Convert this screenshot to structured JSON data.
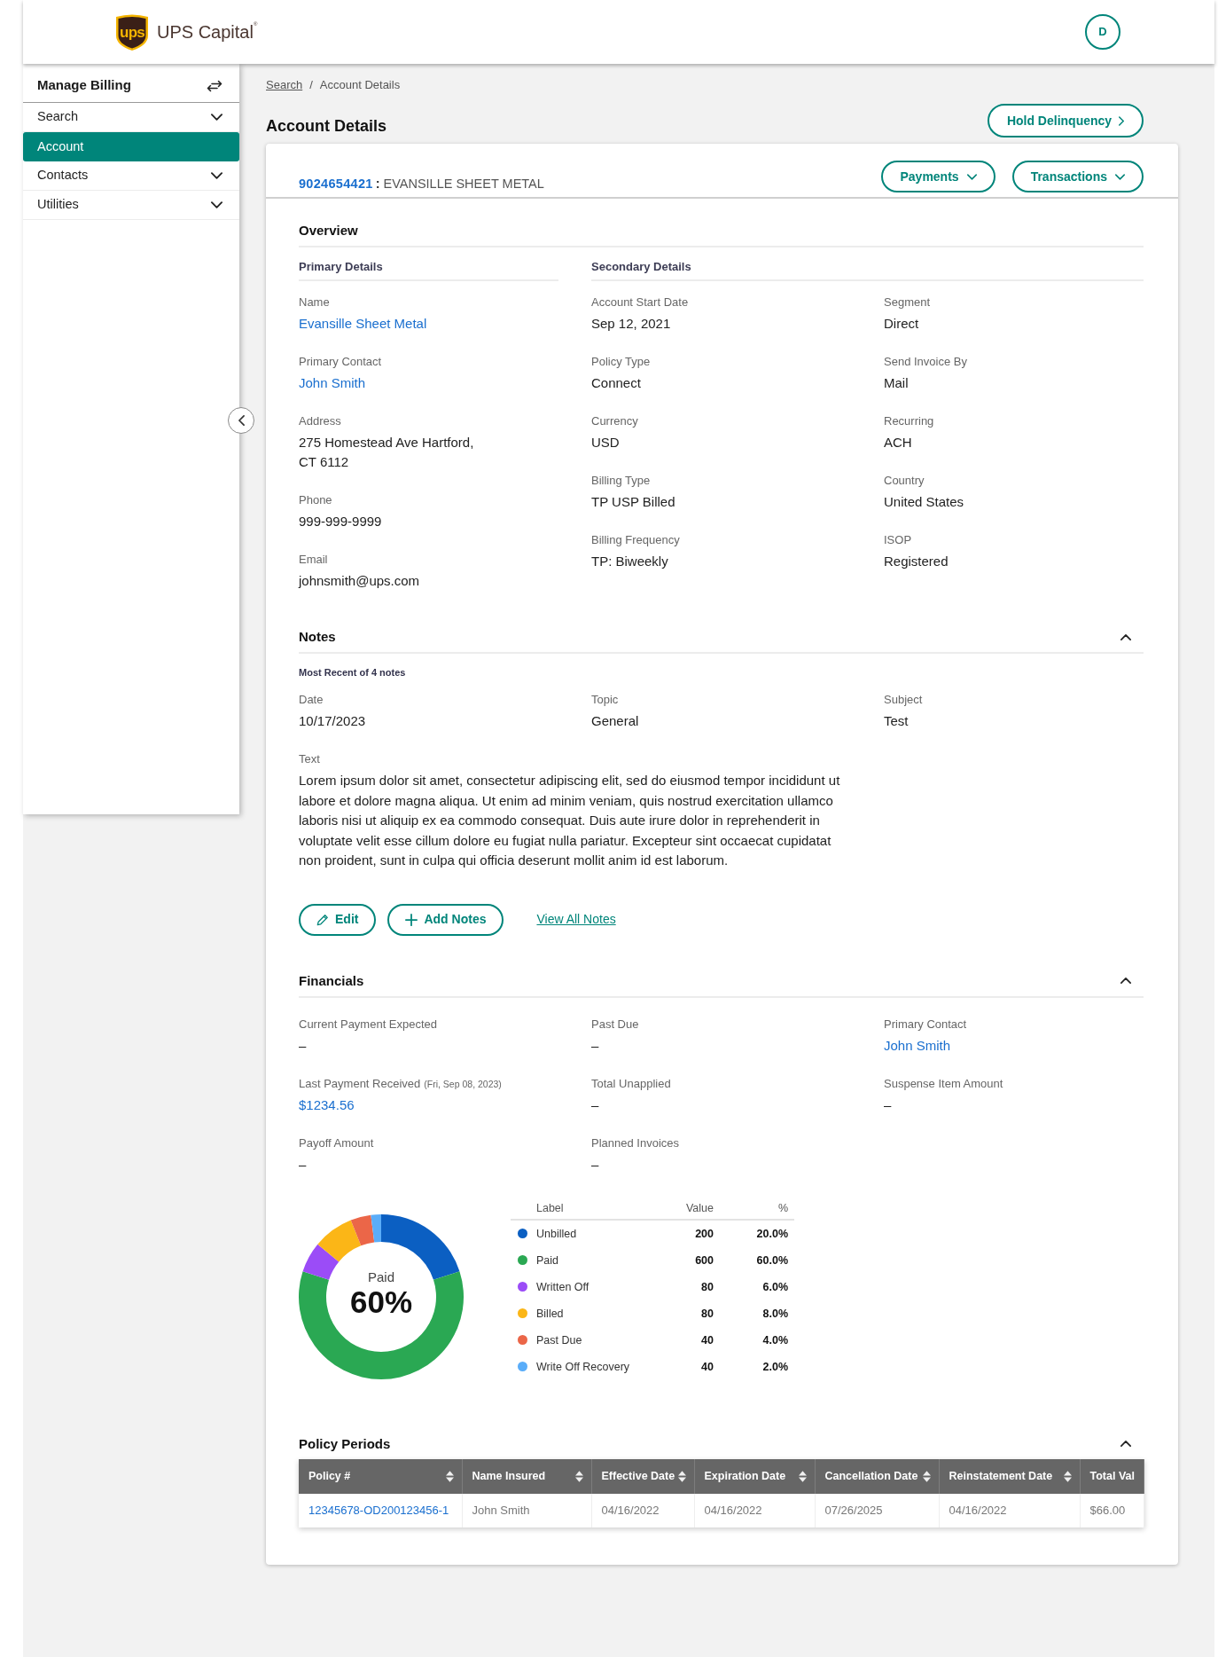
{
  "header": {
    "logo": {
      "mark": "ups",
      "name": "UPS Capital$^{®}$"
    },
    "avatar": "D"
  },
  "sidebar": {
    "title": "Manage Billing",
    "items": [
      {
        "label": "Search",
        "kind": "group",
        "selected": false
      },
      {
        "label": "Account",
        "kind": "link",
        "selected": true
      },
      {
        "label": "Contacts",
        "kind": "group",
        "selected": false
      },
      {
        "label": "Utilities",
        "kind": "group",
        "selected": false
      }
    ]
  },
  "breadcrumb": {
    "items": [
      {
        "label": "Search",
        "link": true
      },
      {
        "label": "Account Details",
        "link": false
      }
    ],
    "separator": "/"
  },
  "page_title": "Account Details",
  "hold_button": "Hold Delinquency",
  "account": {
    "number": "9024654421",
    "separator": ":",
    "name": "EVANSILLE SHEET METAL",
    "actions": [
      "Payments",
      "Transactions"
    ]
  },
  "overview": {
    "title": "Overview",
    "primary": {
      "title": "Primary Details",
      "fields": [
        {
          "label": "Name",
          "value": "Evansille Sheet Metal",
          "link": true
        },
        {
          "label": "Primary Contact",
          "value": "John Smith",
          "link": true
        },
        {
          "label": "Address",
          "value": "275 Homestead Ave Hartford, CT 6112",
          "link": false
        },
        {
          "label": "Phone",
          "value": "999-999-9999",
          "link": false
        },
        {
          "label": "Email",
          "value": "johnsmith@ups.com",
          "link": false
        }
      ]
    },
    "secondary": {
      "title": "Secondary Details",
      "fields": [
        {
          "label": "Account Start Date",
          "value": "Sep 12, 2021",
          "link": false
        },
        {
          "label": "Segment",
          "value": "Direct",
          "link": false
        },
        {
          "label": "Policy Type",
          "value": "Connect",
          "link": false
        },
        {
          "label": "Send Invoice By",
          "value": "Mail",
          "link": false
        },
        {
          "label": "Currency",
          "value": "USD",
          "link": false
        },
        {
          "label": "Recurring",
          "value": "ACH",
          "link": false
        },
        {
          "label": "Billing Type",
          "value": "TP USP Billed",
          "link": false
        },
        {
          "label": "Country",
          "value": "United States",
          "link": false
        },
        {
          "label": "Billing Frequency",
          "value": "TP: Biweekly",
          "link": false
        },
        {
          "label": "ISOP",
          "value": "Registered",
          "link": false
        }
      ]
    }
  },
  "notes": {
    "title": "Notes",
    "expanded": true,
    "summary": "Most Recent of 4 notes",
    "fields": [
      {
        "label": "Date",
        "value": "10/17/2023",
        "link": false
      },
      {
        "label": "Topic",
        "value": "General",
        "link": false
      },
      {
        "label": "Subject",
        "value": "Test",
        "link": false
      }
    ],
    "text_label": "Text",
    "text": "Lorem ipsum dolor sit amet, consectetur adipiscing elit, sed do eiusmod tempor incididunt ut labore et dolore magna aliqua. Ut enim ad minim veniam, quis nostrud exercitation ullamco laboris nisi ut aliquip ex ea commodo consequat. Duis aute irure dolor in reprehenderit in voluptate velit esse cillum dolore eu fugiat nulla pariatur. Excepteur sint occaecat cupidatat non proident, sunt in culpa qui officia deserunt mollit anim id est laborum.",
    "actions": [
      {
        "label": "Edit",
        "kind": "edit"
      },
      {
        "label": "Add Notes",
        "kind": "add"
      }
    ],
    "view_all": "View All Notes"
  },
  "financials": {
    "title": "Financials",
    "expanded": true,
    "fields": [
      {
        "label": "Current Payment Expected",
        "value": "–",
        "link": false
      },
      {
        "label": "Past Due",
        "value": "–",
        "link": false
      },
      {
        "label": "Primary Contact",
        "value": "John Smith",
        "link": true
      },
      {
        "label": "Last Payment Received",
        "note": "(Fri, Sep 08, 2023)",
        "value": "$1234.56",
        "link": true
      },
      {
        "label": "Total Unapplied",
        "value": "–",
        "link": false
      },
      {
        "label": "Suspense Item Amount",
        "value": "–",
        "link": false
      },
      {
        "label": "Payoff Amount",
        "value": "–",
        "link": false
      },
      {
        "label": "Planned Invoices",
        "value": "–",
        "link": false
      }
    ],
    "chart": {
      "center_label": "Paid",
      "center_value": "60%",
      "chart_data": {
        "type": "donut",
        "categories": [
          "Unbilled",
          "Paid",
          "Written Off",
          "Billed",
          "Past Due",
          "Write Off Recovery"
        ],
        "series": [
          {
            "name": "%",
            "values": [
              20,
              60,
              6,
              8,
              4,
              2
            ]
          }
        ]
      }
    },
    "legend": {
      "columns": [
        "Label",
        "Value"
      ],
      "rows": [
        {
          "value": "200",
          "percent": "20.0%",
          "color": "#0b5fc2"
        },
        {
          "value": "600",
          "percent": "60.0%",
          "color": "#2aa853"
        },
        {
          "value": "80",
          "percent": "6.0%",
          "color": "#9b4cf7"
        },
        {
          "value": "80",
          "percent": "8.0%",
          "color": "#fbb617"
        },
        {
          "value": "40",
          "percent": "4.0%",
          "color": "#eb6648"
        },
        {
          "value": "40",
          "percent": "2.0%",
          "color": "#5aadf9"
        }
      ]
    }
  },
  "policy_periods": {
    "title": "Policy Periods",
    "expanded": true,
    "columns": [
      {
        "label": "Policy #",
        "sortable": true,
        "link": true
      },
      {
        "label": "Name Insured",
        "sortable": true,
        "link": false
      },
      {
        "label": "Effective Date",
        "sortable": true,
        "link": false
      },
      {
        "label": "Expiration Date",
        "sortable": true,
        "link": false
      },
      {
        "label": "Cancellation Date",
        "sortable": true,
        "link": false
      },
      {
        "label": "Reinstatement Date",
        "sortable": true,
        "link": false
      },
      {
        "label": "Total Val",
        "sortable": false,
        "link": false
      }
    ],
    "rows": [
      {
        "cells": [
          "12345678-OD200123456-1",
          "John Smith",
          "04/16/2022",
          "04/16/2022",
          "07/26/2025",
          "04/16/2022",
          "$66.00"
        ]
      }
    ]
  }
}
